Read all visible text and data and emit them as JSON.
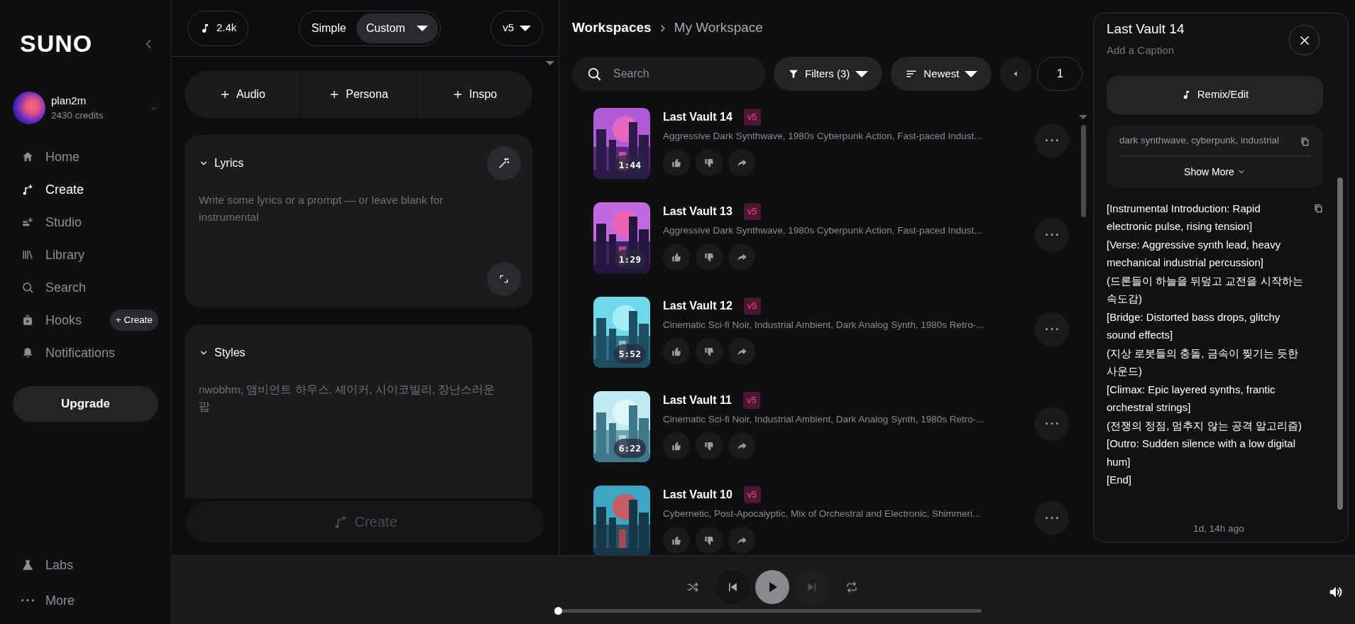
{
  "sidebar": {
    "logo": "SUNO",
    "user": {
      "name": "plan2m",
      "credits": "2430 credits"
    },
    "nav": [
      {
        "label": "Home",
        "selected": false
      },
      {
        "label": "Create",
        "selected": true
      },
      {
        "label": "Studio",
        "selected": false
      },
      {
        "label": "Library",
        "selected": false
      },
      {
        "label": "Search",
        "selected": false
      },
      {
        "label": "Hooks",
        "selected": false,
        "action": "+ Create"
      },
      {
        "label": "Notifications",
        "selected": false
      }
    ],
    "upgrade": "Upgrade",
    "footer": [
      {
        "label": "Labs"
      },
      {
        "label": "More"
      }
    ]
  },
  "create_panel": {
    "credits": "2.4k",
    "modes": [
      {
        "label": "Simple",
        "selected": false
      },
      {
        "label": "Custom",
        "selected": true
      }
    ],
    "model": "v5",
    "add_buttons": [
      "Audio",
      "Persona",
      "Inspo"
    ],
    "lyrics": {
      "title": "Lyrics",
      "placeholder": "Write some lyrics or a prompt — or leave blank for instrumental"
    },
    "styles": {
      "title": "Styles",
      "placeholder": "nwobhm, 앰비언트 하우스, 셰이커, 사이코빌리, 장난스러운 팝"
    },
    "create_button": {
      "label": "Create",
      "disabled": true
    }
  },
  "workspace": {
    "breadcrumb": [
      "Workspaces",
      "My Workspace"
    ],
    "search": {
      "placeholder": "Search"
    },
    "filters": "Filters (3)",
    "sort": "Newest",
    "page": "1",
    "songs": [
      {
        "title": "Last Vault 14",
        "version": "v5",
        "description": "Aggressive Dark Synthwave, 1980s Cyberpunk Action, Fast-paced Indust...",
        "duration": "1:44"
      },
      {
        "title": "Last Vault 13",
        "version": "v5",
        "description": "Aggressive Dark Synthwave, 1980s Cyberpunk Action, Fast-paced Indust...",
        "duration": "1:29"
      },
      {
        "title": "Last Vault 12",
        "version": "v5",
        "description": "Cinematic Sci-fi Noir, Industrial Ambient, Dark Analog Synth, 1980s Retro-...",
        "duration": "5:52"
      },
      {
        "title": "Last Vault 11",
        "version": "v5",
        "description": "Cinematic Sci-fi Noir, Industrial Ambient, Dark Analog Synth, 1980s Retro-...",
        "duration": "6:22"
      },
      {
        "title": "Last Vault 10",
        "version": "v5",
        "description": "Cybernetic, Post-Apocalyptic, Mix of Orchestral and Electronic, Shimmeri..."
      }
    ]
  },
  "detail": {
    "title": "Last Vault 14",
    "caption_placeholder": "Add a Caption",
    "remix": "Remix/Edit",
    "tags": "dark synthwave, cyberpunk, industrial",
    "show_more": "Show More",
    "lyrics": [
      "[Instrumental Introduction: Rapid electronic pulse, rising tension]",
      "[Verse: Aggressive synth lead, heavy mechanical industrial percussion]",
      "(드론들이 하늘을 뒤덮고 교전을 시작하는 속도감)",
      "[Bridge: Distorted bass drops, glitchy sound effects]",
      "(지상 로봇들의 충돌, 금속이 찢기는 듯한 사운드)",
      "[Climax: Epic layered synths, frantic orchestral strings]",
      "(전쟁의 정점, 멈추지 않는 공격 알고리즘)",
      "[Outro: Sudden silence with a low digital hum]",
      "[End]"
    ],
    "time": "1d, 14h ago"
  },
  "player": {
    "level": 0
  }
}
